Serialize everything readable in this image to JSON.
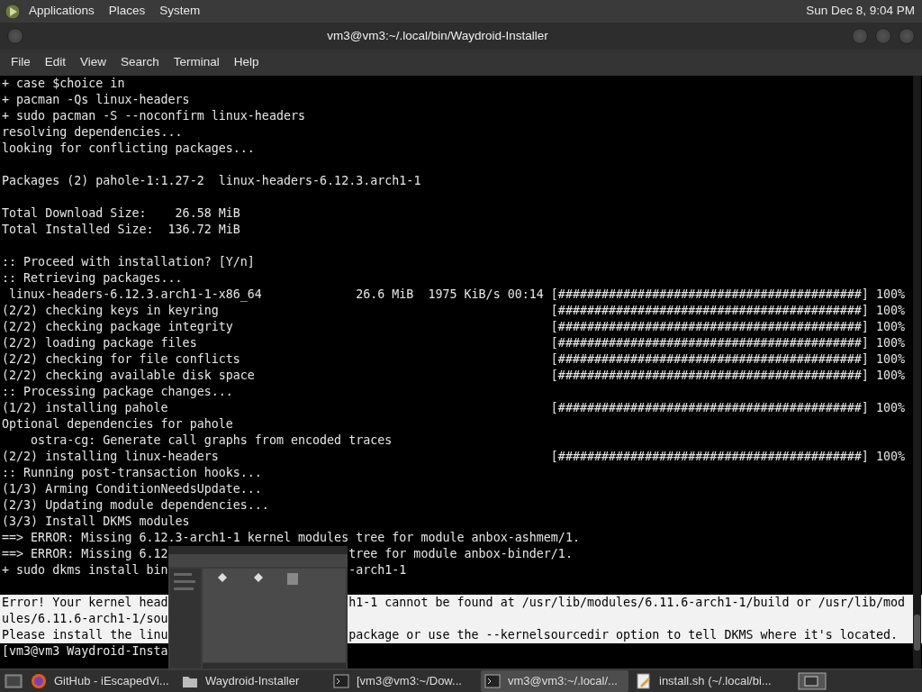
{
  "top_panel": {
    "menus": [
      "Applications",
      "Places",
      "System"
    ],
    "clock": "Sun Dec 8, 9:04 PM"
  },
  "window": {
    "title": "vm3@vm3:~/.local/bin/Waydroid-Installer"
  },
  "menu_bar": [
    "File",
    "Edit",
    "View",
    "Search",
    "Terminal",
    "Help"
  ],
  "terminal": {
    "lines": [
      {
        "kind": "text",
        "text": "+ case $choice in"
      },
      {
        "kind": "text",
        "text": "+ pacman -Qs linux-headers"
      },
      {
        "kind": "text",
        "text": "+ sudo pacman -S --noconfirm linux-headers"
      },
      {
        "kind": "text",
        "text": "resolving dependencies..."
      },
      {
        "kind": "text",
        "text": "looking for conflicting packages..."
      },
      {
        "kind": "blank"
      },
      {
        "kind": "text",
        "text": "Packages (2) pahole-1:1.27-2  linux-headers-6.12.3.arch1-1"
      },
      {
        "kind": "blank"
      },
      {
        "kind": "text",
        "text": "Total Download Size:    26.58 MiB"
      },
      {
        "kind": "text",
        "text": "Total Installed Size:  136.72 MiB"
      },
      {
        "kind": "blank"
      },
      {
        "kind": "text",
        "text": ":: Proceed with installation? [Y/n]"
      },
      {
        "kind": "text",
        "text": ":: Retrieving packages..."
      },
      {
        "kind": "progress",
        "text": " linux-headers-6.12.3.arch1-1-x86_64             26.6 MiB  1975 KiB/s 00:14",
        "bar": "[##########################################]",
        "reading": "100%"
      },
      {
        "kind": "progress",
        "text": "(2/2) checking keys in keyring",
        "bar": "[##########################################]",
        "reading": "100%"
      },
      {
        "kind": "progress",
        "text": "(2/2) checking package integrity",
        "bar": "[##########################################]",
        "reading": "100%"
      },
      {
        "kind": "progress",
        "text": "(2/2) loading package files",
        "bar": "[##########################################]",
        "reading": "100%"
      },
      {
        "kind": "progress",
        "text": "(2/2) checking for file conflicts",
        "bar": "[##########################################]",
        "reading": "100%"
      },
      {
        "kind": "progress",
        "text": "(2/2) checking available disk space",
        "bar": "[##########################################]",
        "reading": "100%"
      },
      {
        "kind": "text",
        "text": ":: Processing package changes..."
      },
      {
        "kind": "progress",
        "text": "(1/2) installing pahole",
        "bar": "[##########################################]",
        "reading": "100%"
      },
      {
        "kind": "text",
        "text": "Optional dependencies for pahole"
      },
      {
        "kind": "text",
        "text": "    ostra-cg: Generate call graphs from encoded traces"
      },
      {
        "kind": "progress",
        "text": "(2/2) installing linux-headers",
        "bar": "[##########################################]",
        "reading": "100%"
      },
      {
        "kind": "text",
        "text": ":: Running post-transaction hooks..."
      },
      {
        "kind": "text",
        "text": "(1/3) Arming ConditionNeedsUpdate..."
      },
      {
        "kind": "text",
        "text": "(2/3) Updating module dependencies..."
      },
      {
        "kind": "text",
        "text": "(3/3) Install DKMS modules"
      },
      {
        "kind": "text",
        "text": "==> ERROR: Missing 6.12.3-arch1-1 kernel modules tree for module anbox-ashmem/1."
      },
      {
        "kind": "covered",
        "text": "==> ERROR: Missing 6.12",
        "after": "tree for module anbox-binder/1.",
        "selected": false
      },
      {
        "kind": "covered",
        "text": "+ sudo dkms install bin",
        "after": "-arch1-1",
        "selected": false
      },
      {
        "kind": "blank"
      },
      {
        "kind": "covered",
        "text": "Error! Your kernel head",
        "after": "h1-1 cannot be found at /usr/lib/modules/6.11.6-arch1-1/build or /usr/lib/mod",
        "selected": true
      },
      {
        "kind": "covered",
        "text": "ules/6.11.6-arch1-1/sou",
        "selected": true
      },
      {
        "kind": "covered",
        "text": "Please install the linu",
        "after": "package or use the --kernelsourcedir option to tell DKMS where it's located.",
        "selected": true
      },
      {
        "kind": "covered",
        "text": "[vm3@vm3 Waydroid-Insta",
        "selected": false
      }
    ]
  },
  "taskbar": {
    "items": [
      {
        "kind": "browser",
        "label": "GitHub - iEscapedVi...",
        "selected": false
      },
      {
        "kind": "folder",
        "label": "Waydroid-Installer",
        "selected": false
      },
      {
        "kind": "terminal",
        "label": "[vm3@vm3:~/Dow...",
        "selected": false
      },
      {
        "kind": "terminal",
        "label": "vm3@vm3:~/.local/...",
        "selected": true
      },
      {
        "kind": "editor",
        "label": "install.sh (~/.local/bi...",
        "selected": false
      }
    ]
  }
}
